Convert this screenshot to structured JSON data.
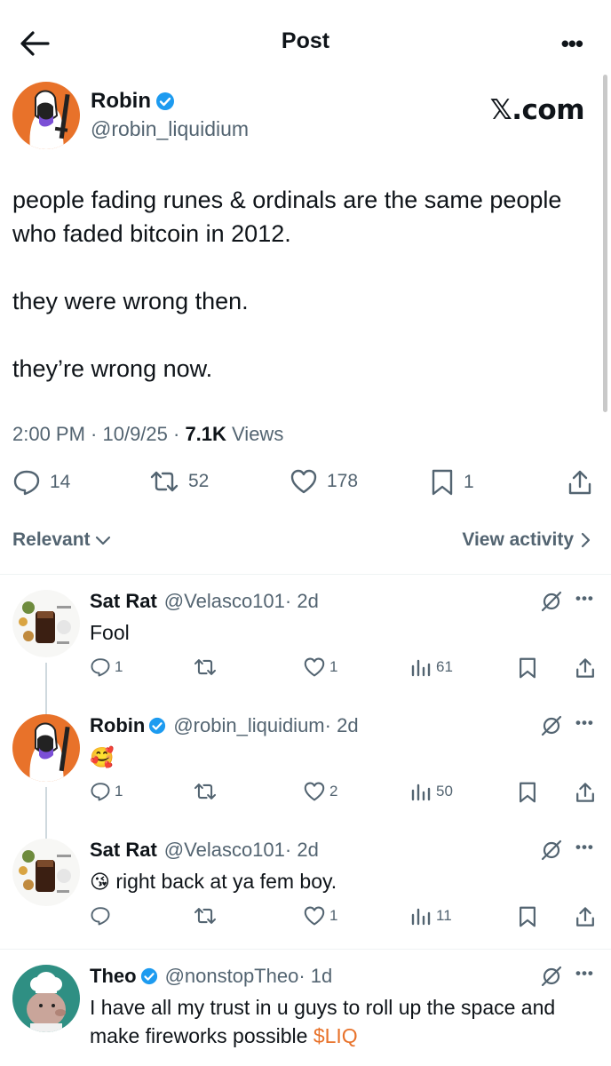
{
  "header": {
    "title": "Post",
    "more": "•••"
  },
  "post": {
    "author_name": "Robin",
    "author_handle": "@robin_liquidium",
    "source_label": "𝕏.com",
    "text": "people fading runes & ordinals are the same people who faded bitcoin in 2012.\n\n they were wrong then.\n\n they’re wrong now.",
    "time": "2:00 PM · 10/9/25 · ",
    "views_count": "7.1K",
    "views_label": " Views",
    "stats": {
      "replies": "14",
      "reposts": "52",
      "likes": "178",
      "bookmarks": "1"
    }
  },
  "filter": {
    "left_label": "Relevant",
    "right_label": "View activity"
  },
  "replies": [
    {
      "name": "Sat Rat",
      "handle": "@Velasco101",
      "time": "· 2d",
      "emoji": "",
      "text": "Fool",
      "replies": "1",
      "reposts": "",
      "likes": "1",
      "views": "61"
    },
    {
      "name": "Robin",
      "handle": "@robin_liquidium",
      "time": "· 2d",
      "emoji": "🥰",
      "text": "",
      "replies": "1",
      "reposts": "",
      "likes": "2",
      "views": "50"
    },
    {
      "name": "Sat Rat",
      "handle": "@Velasco101",
      "time": "· 2d",
      "emoji": "😘",
      "text": " right back at ya fem boy.",
      "replies": "",
      "reposts": "",
      "likes": "1",
      "views": "11"
    },
    {
      "name": "Theo",
      "handle": "@nonstopTheo",
      "time": "· 1d",
      "emoji": "",
      "text": "I have all my trust in u guys to roll up the space and make fireworks possible ",
      "cashtag": "$LIQ"
    }
  ],
  "colors": {
    "verified": "#1d9bf0",
    "robin_avatar_bg": "#e8722a",
    "theo_avatar_bg": "#2f8f83",
    "cashtag": "#e8722a",
    "muted": "#536471"
  }
}
